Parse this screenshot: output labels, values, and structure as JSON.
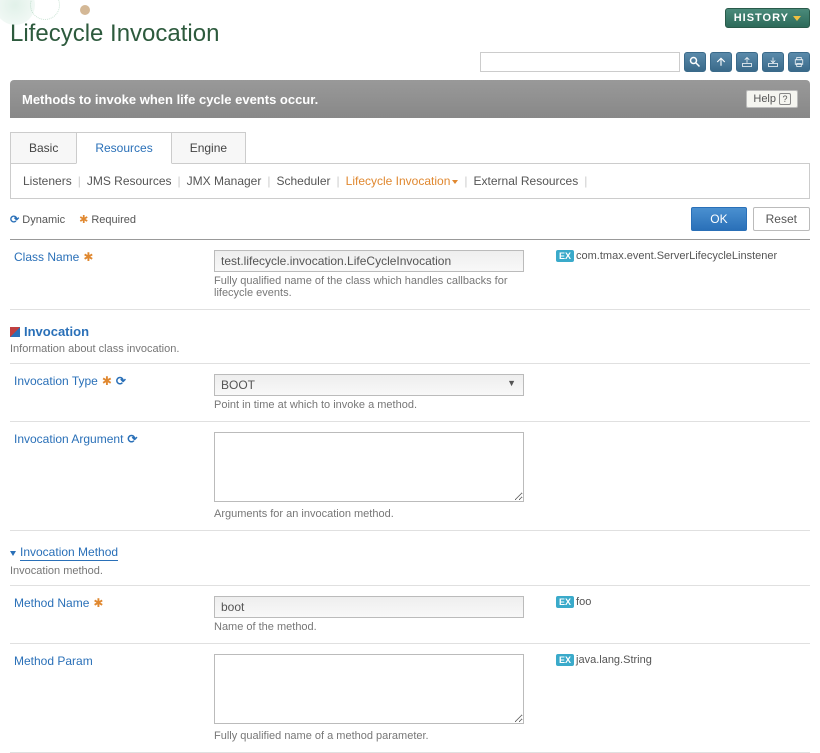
{
  "header": {
    "title": "Lifecycle Invocation",
    "history_label": "HISTORY"
  },
  "banner": {
    "text": "Methods to invoke when life cycle events occur.",
    "help_label": "Help"
  },
  "tabs_primary": [
    "Basic",
    "Resources",
    "Engine"
  ],
  "tabs_primary_active": 1,
  "tabs_secondary": [
    "Listeners",
    "JMS Resources",
    "JMX Manager",
    "Scheduler",
    "Lifecycle Invocation",
    "External Resources"
  ],
  "tabs_secondary_active": 4,
  "legend": {
    "dynamic": "Dynamic",
    "required": "Required"
  },
  "buttons": {
    "ok": "OK",
    "reset": "Reset"
  },
  "fields": {
    "class_name": {
      "label": "Class Name",
      "value": "test.lifecycle.invocation.LifeCycleInvocation",
      "helper": "Fully qualified name of the class which handles callbacks for lifecycle events.",
      "example": "com.tmax.event.ServerLifecycleLinstener"
    },
    "invocation_type": {
      "label": "Invocation Type",
      "value": "BOOT",
      "helper": "Point in time at which to invoke a method."
    },
    "invocation_argument": {
      "label": "Invocation Argument",
      "value": "",
      "helper": "Arguments for an invocation method."
    },
    "method_name": {
      "label": "Method Name",
      "value": "boot",
      "helper": "Name of the method.",
      "example": "foo"
    },
    "method_param": {
      "label": "Method Param",
      "value": "",
      "helper": "Fully qualified name of a method parameter.",
      "example": "java.lang.String"
    }
  },
  "sections": {
    "invocation": {
      "title": "Invocation",
      "desc": "Information about class invocation."
    },
    "invocation_method": {
      "title": "Invocation Method",
      "desc": "Invocation method."
    }
  }
}
